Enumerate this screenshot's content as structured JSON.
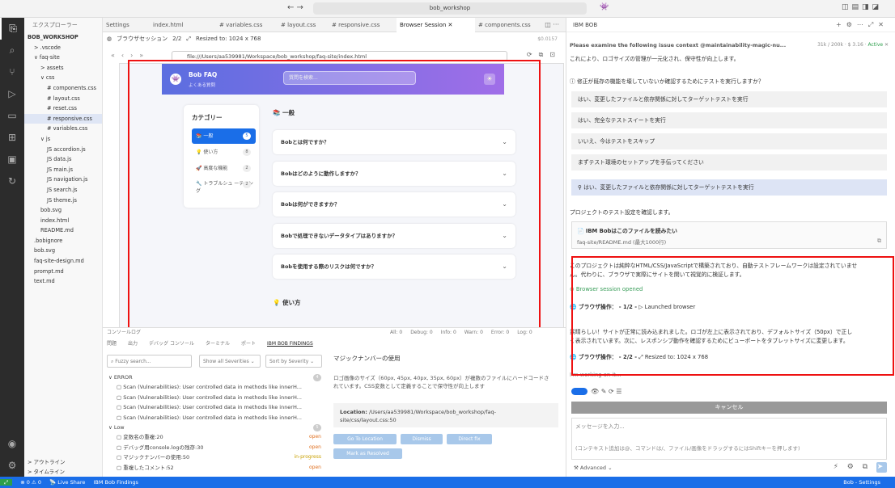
{
  "titlebar": {
    "search": "bob_workshop"
  },
  "explorer": {
    "header": "エクスプローラー",
    "root": "BOB_WORKSHOP",
    "items": [
      {
        "label": "> .vscode",
        "indent": 1
      },
      {
        "label": "∨ faq-site",
        "indent": 1
      },
      {
        "label": "> assets",
        "indent": 2
      },
      {
        "label": "∨ css",
        "indent": 2
      },
      {
        "label": "# components.css",
        "indent": 3
      },
      {
        "label": "# layout.css",
        "indent": 3
      },
      {
        "label": "# reset.css",
        "indent": 3
      },
      {
        "label": "# responsive.css",
        "indent": 3,
        "selected": true
      },
      {
        "label": "# variables.css",
        "indent": 3
      },
      {
        "label": "∨ js",
        "indent": 2
      },
      {
        "label": "JS accordion.js",
        "indent": 3
      },
      {
        "label": "JS data.js",
        "indent": 3
      },
      {
        "label": "JS main.js",
        "indent": 3
      },
      {
        "label": "JS navigation.js",
        "indent": 3
      },
      {
        "label": "JS search.js",
        "indent": 3
      },
      {
        "label": "JS theme.js",
        "indent": 3
      },
      {
        "label": "bob.svg",
        "indent": 2
      },
      {
        "label": "index.html",
        "indent": 2
      },
      {
        "label": "README.md",
        "indent": 2
      },
      {
        "label": ".bobignore",
        "indent": 1
      },
      {
        "label": "bob.svg",
        "indent": 1
      },
      {
        "label": "faq-site-design.md",
        "indent": 1
      },
      {
        "label": "prompt.md",
        "indent": 1
      },
      {
        "label": "text.md",
        "indent": 1
      }
    ],
    "outline": "> アウトライン",
    "timeline": "> タイムライン"
  },
  "tabs": [
    {
      "label": "Settings",
      "active": false
    },
    {
      "label": "index.html",
      "active": false
    },
    {
      "label": "# variables.css",
      "active": false
    },
    {
      "label": "# layout.css",
      "active": false
    },
    {
      "label": "# responsive.css",
      "active": false
    },
    {
      "label": "Browser Session",
      "active": true
    },
    {
      "label": "# components.css",
      "active": false
    }
  ],
  "browser": {
    "session_label": "ブラウザセッション",
    "step": "2/2",
    "resize": "Resized to: 1024 x 768",
    "cost": "$0.0157",
    "url": "file:///Users/aa539981/Workspace/bob_workshop/faq-site/index.html"
  },
  "faq": {
    "title": "Bob FAQ",
    "subtitle": "よくある質問",
    "search_placeholder": "質問を検索...",
    "category_title": "カテゴリー",
    "categories": [
      {
        "label": "📚 一般",
        "count": "5",
        "active": true
      },
      {
        "label": "💡 使い方",
        "count": "8",
        "active": false
      },
      {
        "label": "🚀 高度な機能",
        "count": "2",
        "active": false
      },
      {
        "label": "🔧 トラブルシュ ーティング",
        "count": "2",
        "active": false
      }
    ],
    "section_title": "📚 一般",
    "questions": [
      "Bobとは何ですか？",
      "Bobはどのように動作しますか？",
      "Bobは何ができますか？",
      "Bobで処理できないデータタイプはありますか？",
      "Bobを使用する際のリスクは何ですか？"
    ],
    "section_title2": "💡 使い方"
  },
  "panel": {
    "console": "コンソールログ",
    "filters": [
      "All: 0",
      "Debug: 0",
      "Info: 0",
      "Warn: 0",
      "Error: 0",
      "Log: 0"
    ],
    "tabs": [
      "問題",
      "出力",
      "デバッグ コンソール",
      "ターミナル",
      "ポート",
      "IBM BOB FINDINGS"
    ],
    "search_placeholder": "Fuzzy search...",
    "severity_filter": "Show all Severities",
    "sort_filter": "Sort by Severity",
    "findings": [
      {
        "label": "∨ ERROR",
        "badge": "4",
        "type": "group"
      },
      {
        "label": "Scan (Vulnerabilities): User controlled data in methods like innerH...",
        "type": "item"
      },
      {
        "label": "Scan (Vulnerabilities): User controlled data in methods like innerH...",
        "type": "item"
      },
      {
        "label": "Scan (Vulnerabilities): User controlled data in methods like innerH...",
        "type": "item"
      },
      {
        "label": "Scan (Vulnerabilities): User controlled data in methods like innerH...",
        "type": "item"
      },
      {
        "label": "∨ Low",
        "badge": "5",
        "type": "group"
      },
      {
        "label": "変数名の重複:20",
        "status": "open",
        "type": "item"
      },
      {
        "label": "デバッグ用console.logの残存:30",
        "status": "open",
        "type": "item"
      },
      {
        "label": "マジックナンバーの使用:50",
        "status": "in-progress",
        "type": "item"
      },
      {
        "label": "重複したコメント:52",
        "status": "open",
        "type": "item"
      }
    ],
    "detail": {
      "title": "マジックナンバーの使用",
      "desc": "ロゴ画像のサイズ（60px, 45px, 40px, 35px, 60px）が複数のファイルにハードコードされています。CSS変数として定義することで保守性が向上します",
      "location_label": "Location:",
      "location": "/Users/aa539981/Workspace/bob_workshop/faq-site/css/layout.css:50",
      "buttons": [
        "Go To Location",
        "Dismiss",
        "Direct fix",
        "Mark as Resolved"
      ]
    }
  },
  "bob": {
    "title": "IBM BOB",
    "context": "Please examine the following issue context @maintainability-magic-nu...",
    "tokens": "31k / 200k",
    "cost": "$ 3.16",
    "status": "Active",
    "intro": "これにより、ロゴサイズの管理が一元化され、保守性が向上します。",
    "question": "修正が既存の機能を壊していないか確認するためにテストを実行しますか？",
    "options": [
      "はい、変更したファイルと依存関係に対してターゲットテストを実行",
      "はい、完全なテストスイートを実行",
      "いいえ、今はテストをスキップ",
      "まずテスト環境のセットアップを手伝ってください"
    ],
    "selected": "はい、変更したファイルと依存関係に対してターゲットテストを実行",
    "check_msg": "プロジェクトのテスト設定を確認します。",
    "card_title": "IBM Bobはこのファイルを読みたい",
    "card_sub": "faq-site/README.md (最大1000行)",
    "msg1": "このプロジェクトは純粋なHTML/CSS/JavaScriptで構築されており、自動テストフレームワークは設定されていませ",
    "msg1b": "ん。代わりに、ブラウザで実際にサイトを開いて視覚的に検証します。",
    "session_opened": "Browser session opened",
    "op1": "ブラウザ操作： - 1/2 -",
    "op1_detail": "▷  Launched browser",
    "msg2": "素晴らしい！サイトが正常に読み込まれました。ロゴが左上に表示されており、デフォルトサイズ（50px）で正し",
    "msg2b": "く表示されています。次に、レスポンシブ動作を確認するためにビューポートをタブレットサイズに変更します。",
    "op2": "ブラウザ操作： - 2/2 -",
    "op2_detail": "⤢  Resized to: 1024 x 768",
    "working": "I'm working on it...",
    "cancel": "キャンセル",
    "input_placeholder": "メッセージを入力...",
    "input_hint": "(コンテキスト追加は@、コマンドは/、ファイル/画像をドラッグするにはShiftキーを押します)",
    "advanced": "Advanced"
  },
  "statusbar": {
    "left": [
      "⊗ 0 ⚠ 0",
      "📡 Live Share",
      "IBM Bob Findings"
    ],
    "right": "Bob - Settings"
  }
}
